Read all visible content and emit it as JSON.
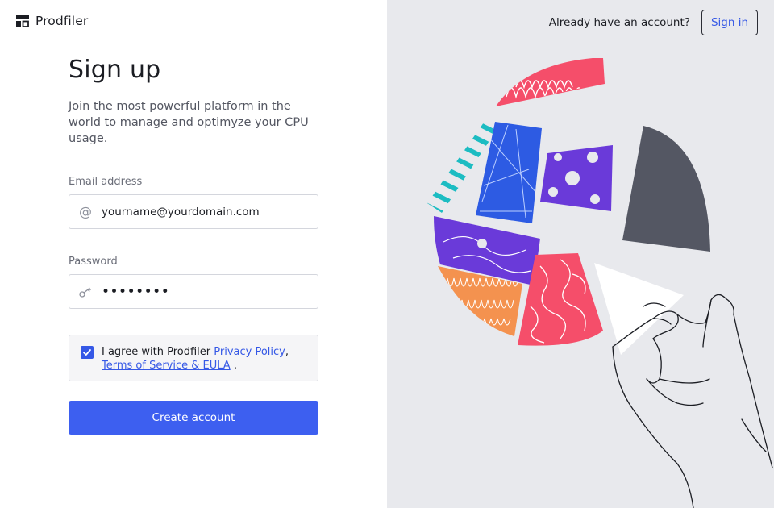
{
  "brand": {
    "name": "Prodfiler"
  },
  "header": {
    "signin_prompt": "Already have an account?",
    "signin_button": "Sign in"
  },
  "form": {
    "title": "Sign up",
    "subtitle": "Join the most powerful platform in the world to manage and optimyze your CPU usage.",
    "email": {
      "label": "Email address",
      "value": "yourname@yourdomain.com",
      "icon": "at-icon"
    },
    "password": {
      "label": "Password",
      "value": "••••••••",
      "icon": "key-icon"
    },
    "agreement": {
      "checked": true,
      "prefix": "I agree with Prodfiler ",
      "privacy_link": "Privacy Policy",
      "comma": ",",
      "terms_link": "Terms of Service & EULA",
      "suffix": " ."
    },
    "submit_button": "Create account"
  },
  "illustration": {
    "name": "hand-pointing-at-pie-chart-illustration"
  },
  "colors": {
    "accent": "#3d5ff0",
    "link": "#3558e6",
    "panel": "#e8e9ed",
    "red": "#f54e6a",
    "blue": "#2d5be3",
    "purple": "#6a3ad9",
    "teal": "#1cbcc2",
    "orange": "#f4924f",
    "slate": "#545763"
  }
}
